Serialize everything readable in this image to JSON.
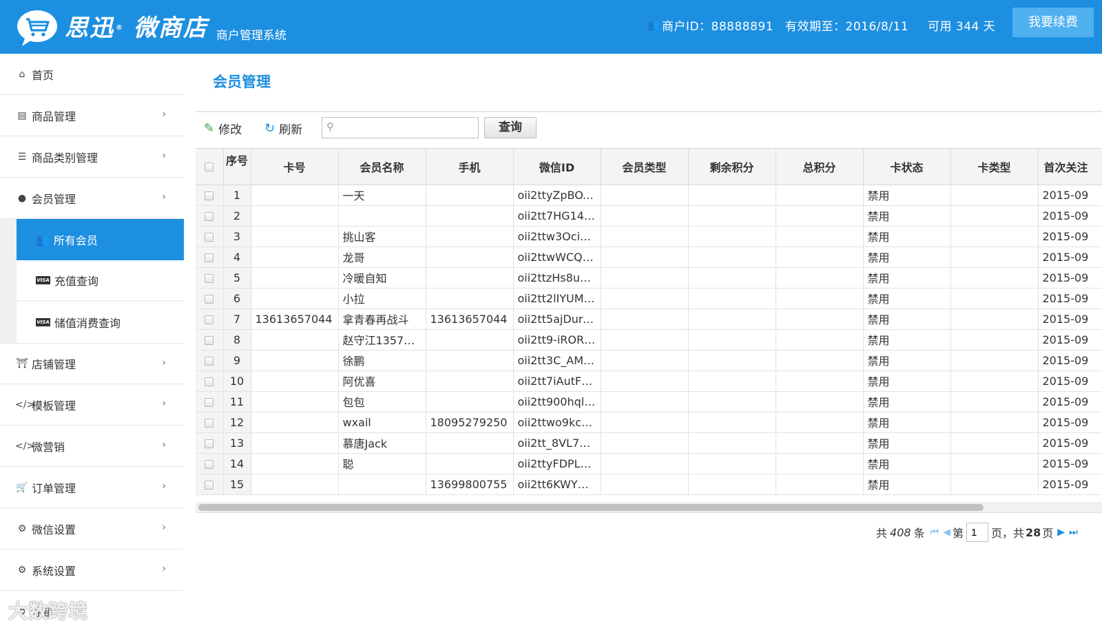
{
  "header": {
    "brand": "思迅",
    "brand2": "微商店",
    "reg_mark": "®",
    "subtitle": "商户管理系统",
    "merchant_id": "商户ID：88888891",
    "valid_until": "有效期至：2016/8/11",
    "available": "可用 344 天",
    "renew_label": "我要续费",
    "accent_color": "#1d8fe0"
  },
  "sidebar": {
    "home": "首页",
    "goods": "商品管理",
    "goods_category": "商品类别管理",
    "members": "会员管理",
    "sub": {
      "all_members": "所有会员",
      "recharge_query": "充值查询",
      "stored_value_query": "储值消费查询"
    },
    "store": "店铺管理",
    "template": "模板管理",
    "marketing": "微营销",
    "orders": "订单管理",
    "wechat_settings": "微信设置",
    "system_settings": "系统设置",
    "logout": "注销"
  },
  "main": {
    "title": "会员管理",
    "toolbar": {
      "edit_label": "修改",
      "refresh_label": "刷新",
      "search_value": "",
      "query_label": "查询"
    },
    "columns": [
      "序号",
      "卡号",
      "会员名称",
      "手机",
      "微信ID",
      "会员类型",
      "剩余积分",
      "总积分",
      "卡状态",
      "卡类型",
      "首次关注"
    ],
    "rows": [
      {
        "no": "1",
        "card": "",
        "name": "一天",
        "phone": "",
        "wechat": "oii2ttyZpBOX…",
        "mtype": "",
        "remain": "",
        "total": "",
        "status": "禁用",
        "ctype": "",
        "first": "2015-09"
      },
      {
        "no": "2",
        "card": "",
        "name": "",
        "phone": "",
        "wechat": "oii2tt7HG14…",
        "mtype": "",
        "remain": "",
        "total": "",
        "status": "禁用",
        "ctype": "",
        "first": "2015-09"
      },
      {
        "no": "3",
        "card": "",
        "name": "挑山客",
        "phone": "",
        "wechat": "oii2ttw3OciO…",
        "mtype": "",
        "remain": "",
        "total": "",
        "status": "禁用",
        "ctype": "",
        "first": "2015-09"
      },
      {
        "no": "4",
        "card": "",
        "name": "龙哥",
        "phone": "",
        "wechat": "oii2ttwWCQY…",
        "mtype": "",
        "remain": "",
        "total": "",
        "status": "禁用",
        "ctype": "",
        "first": "2015-09"
      },
      {
        "no": "5",
        "card": "",
        "name": "冷暖自知",
        "phone": "",
        "wechat": "oii2ttzHs8uc…",
        "mtype": "",
        "remain": "",
        "total": "",
        "status": "禁用",
        "ctype": "",
        "first": "2015-09"
      },
      {
        "no": "6",
        "card": "",
        "name": "小拉",
        "phone": "",
        "wechat": "oii2tt2lIYUM…",
        "mtype": "",
        "remain": "",
        "total": "",
        "status": "禁用",
        "ctype": "",
        "first": "2015-09"
      },
      {
        "no": "7",
        "card": "13613657044",
        "name": "拿青春再战斗",
        "phone": "13613657044",
        "wechat": "oii2tt5ajDure…",
        "mtype": "",
        "remain": "",
        "total": "",
        "status": "禁用",
        "ctype": "",
        "first": "2015-09"
      },
      {
        "no": "8",
        "card": "",
        "name": "赵守江13574…",
        "phone": "",
        "wechat": "oii2tt9-iROR…",
        "mtype": "",
        "remain": "",
        "total": "",
        "status": "禁用",
        "ctype": "",
        "first": "2015-09"
      },
      {
        "no": "9",
        "card": "",
        "name": "徐鹏",
        "phone": "",
        "wechat": "oii2tt3C_AM…",
        "mtype": "",
        "remain": "",
        "total": "",
        "status": "禁用",
        "ctype": "",
        "first": "2015-09"
      },
      {
        "no": "10",
        "card": "",
        "name": "阿优喜",
        "phone": "",
        "wechat": "oii2tt7iAutF1…",
        "mtype": "",
        "remain": "",
        "total": "",
        "status": "禁用",
        "ctype": "",
        "first": "2015-09"
      },
      {
        "no": "11",
        "card": "",
        "name": "包包",
        "phone": "",
        "wechat": "oii2tt900hql…",
        "mtype": "",
        "remain": "",
        "total": "",
        "status": "禁用",
        "ctype": "",
        "first": "2015-09"
      },
      {
        "no": "12",
        "card": "",
        "name": "wxail",
        "phone": "18095279250",
        "wechat": "oii2ttwo9kc3…",
        "mtype": "",
        "remain": "",
        "total": "",
        "status": "禁用",
        "ctype": "",
        "first": "2015-09"
      },
      {
        "no": "13",
        "card": "",
        "name": "慕唐Jack",
        "phone": "",
        "wechat": "oii2tt_8VL7v…",
        "mtype": "",
        "remain": "",
        "total": "",
        "status": "禁用",
        "ctype": "",
        "first": "2015-09"
      },
      {
        "no": "14",
        "card": "",
        "name": "聪",
        "phone": "",
        "wechat": "oii2ttyFDPLQ…",
        "mtype": "",
        "remain": "",
        "total": "",
        "status": "禁用",
        "ctype": "",
        "first": "2015-09"
      },
      {
        "no": "15",
        "card": "",
        "name": "",
        "phone": "13699800755",
        "wechat": "oii2tt6KWYB…",
        "mtype": "",
        "remain": "",
        "total": "",
        "status": "禁用",
        "ctype": "",
        "first": "2015-09"
      }
    ],
    "pager": {
      "total_prefix": "共",
      "total_count": "408",
      "total_suffix": "条",
      "page_prefix": "第",
      "current_page": "1",
      "page_mid": "页，共",
      "total_pages": "28",
      "page_suffix": "页"
    }
  },
  "watermark": "大数跨境"
}
